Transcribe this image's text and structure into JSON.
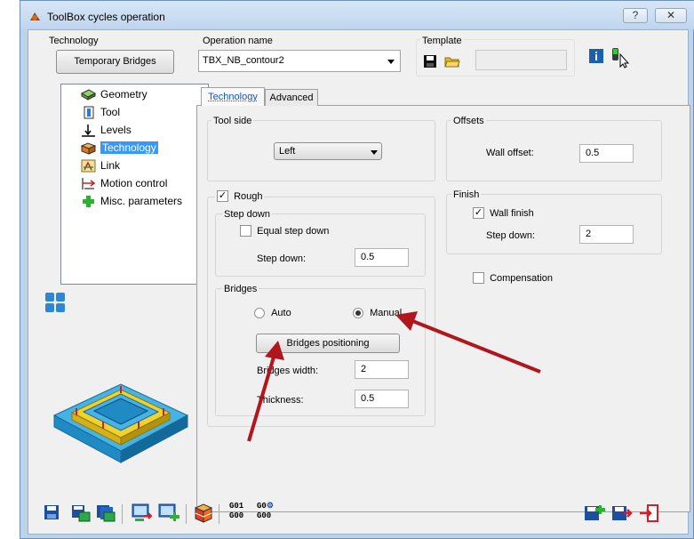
{
  "window": {
    "title": "ToolBox cycles operation",
    "help_glyph": "?",
    "close_glyph": "✕"
  },
  "technology": {
    "label": "Technology",
    "button": "Temporary Bridges"
  },
  "operation": {
    "label": "Operation name",
    "value": "TBX_NB_contour2"
  },
  "template": {
    "label": "Template",
    "value": ""
  },
  "tree": {
    "items": [
      {
        "label": "Geometry",
        "icon": "geometry-icon"
      },
      {
        "label": "Tool",
        "icon": "tool-icon"
      },
      {
        "label": "Levels",
        "icon": "levels-icon"
      },
      {
        "label": "Technology",
        "icon": "technology-icon",
        "selected": true
      },
      {
        "label": "Link",
        "icon": "link-icon"
      },
      {
        "label": "Motion control",
        "icon": "motion-control-icon"
      },
      {
        "label": "Misc. parameters",
        "icon": "plus-icon"
      }
    ]
  },
  "tabs": [
    {
      "label": "Technology",
      "active": true
    },
    {
      "label": "Advanced",
      "active": false
    }
  ],
  "tool_side": {
    "label": "Tool side",
    "value": "Left"
  },
  "offsets": {
    "label": "Offsets",
    "wall_offset_label": "Wall offset:",
    "wall_offset": "0.5"
  },
  "rough": {
    "label": "Rough",
    "checked": true,
    "step_down_group": "Step down",
    "equal_step_label": "Equal step down",
    "equal_step_checked": false,
    "step_down_label": "Step down:",
    "step_down": "0.5"
  },
  "finish": {
    "label": "Finish",
    "wall_finish_label": "Wall finish",
    "wall_finish_checked": true,
    "step_down_label": "Step down:",
    "step_down": "2"
  },
  "compensation": {
    "label": "Compensation",
    "checked": false
  },
  "bridges": {
    "label": "Bridges",
    "auto_label": "Auto",
    "manual_label": "Manual",
    "selected": "Manual",
    "positioning_button": "Bridges positioning",
    "width_label": "Bridges width:",
    "width": "2",
    "thickness_label": "Thickness:",
    "thickness": "0.5"
  },
  "gcode": {
    "g01_top": "G01",
    "g01_bottom": "G00",
    "g02_top": "G0",
    "g02_bottom": "G00"
  },
  "colors": {
    "selection": "#3399ff",
    "annotation_arrow": "#b0161b",
    "title_bg": "#c6d9ef"
  }
}
